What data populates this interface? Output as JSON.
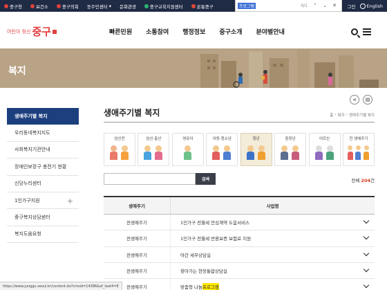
{
  "topbar": {
    "links": [
      "중구청",
      "보건소",
      "중구의회",
      "동주민센터",
      "문화관광",
      "중구교육지원센터",
      "온통중구"
    ],
    "right_login": "그인",
    "language": "English"
  },
  "findbar": {
    "query": "프로그램",
    "count": "0/1"
  },
  "header": {
    "logo_small": "어린이 정신",
    "logo_big": "중구",
    "nav": [
      "빠른민원",
      "소통참여",
      "행정정보",
      "중구소개",
      "분야별안내"
    ]
  },
  "banner": {
    "title": "복지"
  },
  "lnb": {
    "items": [
      {
        "label": "생애주기별 복지",
        "active": true
      },
      {
        "label": "우리동네복지지도"
      },
      {
        "label": "사회복지기관안내"
      },
      {
        "label": "장애인보장구 충전기 현황"
      },
      {
        "label": "신당누리센터"
      },
      {
        "label": "1인가구지원",
        "expand": "+"
      },
      {
        "label": "중구복지상담센터"
      },
      {
        "label": "복지도움요청"
      }
    ]
  },
  "main": {
    "title": "생애주기별 복지",
    "breadcrumb": [
      "홈",
      "복지",
      "생애주기별 복지"
    ],
    "lifecycle_cards": [
      {
        "label": "임신전"
      },
      {
        "label": "임신·출산"
      },
      {
        "label": "영유아"
      },
      {
        "label": "아동·청소년"
      },
      {
        "label": "청년",
        "active": true
      },
      {
        "label": "중장년"
      },
      {
        "label": "어르신"
      },
      {
        "label": "전 생애주기"
      }
    ],
    "search": {
      "placeholder": "",
      "button": "검색"
    },
    "total": {
      "prefix": "전체 ",
      "count": "204",
      "suffix": "건"
    },
    "table": {
      "headers": [
        "생애주기",
        "사업명"
      ],
      "rows": [
        {
          "cycle": "전생애주기",
          "name": "1인가구 전월세 안심계약 도움서비스"
        },
        {
          "cycle": "전생애주기",
          "name": "1인가구 전월세 반환보증 보험료 지원"
        },
        {
          "cycle": "전생애주기",
          "name": "야간 세무상담실"
        },
        {
          "cycle": "전생애주기",
          "name": "찾아가는 현장통합상담실"
        },
        {
          "cycle": "전생애주기",
          "name_pre": "맞춤형 나눔 ",
          "name_hl": "프로그램"
        }
      ]
    }
  },
  "status_url": "https://www.junggu.seoul.kr/content.do?cmsid=14386&of_text4=E",
  "colors": {
    "nav_dark": "#1f2a44",
    "lnb_active": "#1c3f7e",
    "accent_red": "#d9381e",
    "banner": "#b8a386",
    "highlight": "#ffe600"
  }
}
